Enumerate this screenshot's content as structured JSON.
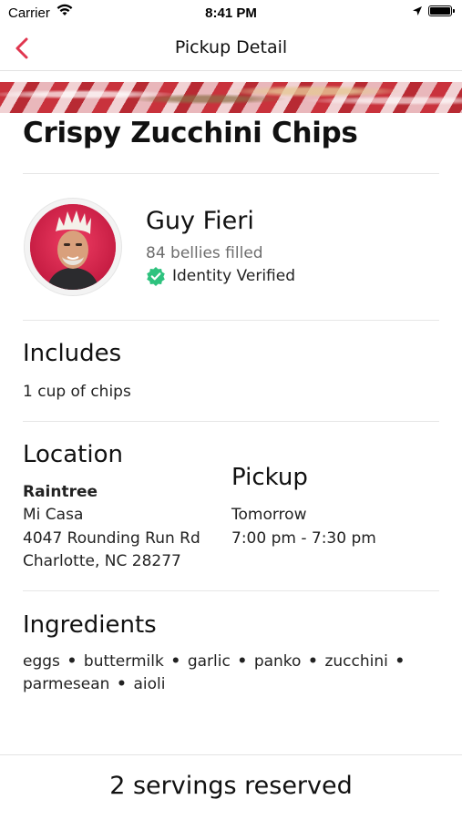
{
  "status_bar": {
    "carrier": "Carrier",
    "time": "8:41 PM"
  },
  "nav": {
    "title": "Pickup Detail",
    "back_icon": "chevron-left-icon",
    "accent_color": "#e0364f"
  },
  "item": {
    "title": "Crispy Zucchini Chips"
  },
  "chef": {
    "name": "Guy Fieri",
    "stats": "84 bellies filled",
    "verified_label": "Identity Verified",
    "verified_color": "#2ec27e"
  },
  "includes": {
    "heading": "Includes",
    "text": "1 cup of chips"
  },
  "location": {
    "heading": "Location",
    "neighborhood": "Raintree",
    "place": "Mi Casa",
    "street": "4047 Rounding Run Rd",
    "city": "Charlotte, NC 28277"
  },
  "pickup": {
    "heading": "Pickup",
    "day": "Tomorrow",
    "window": "7:00 pm - 7:30 pm"
  },
  "ingredients": {
    "heading": "Ingredients",
    "separator": "•",
    "items": [
      "eggs",
      "buttermilk",
      "garlic",
      "panko",
      "zucchini",
      "parmesean",
      "aioli"
    ]
  },
  "footer": {
    "reserved": "2 servings reserved"
  }
}
